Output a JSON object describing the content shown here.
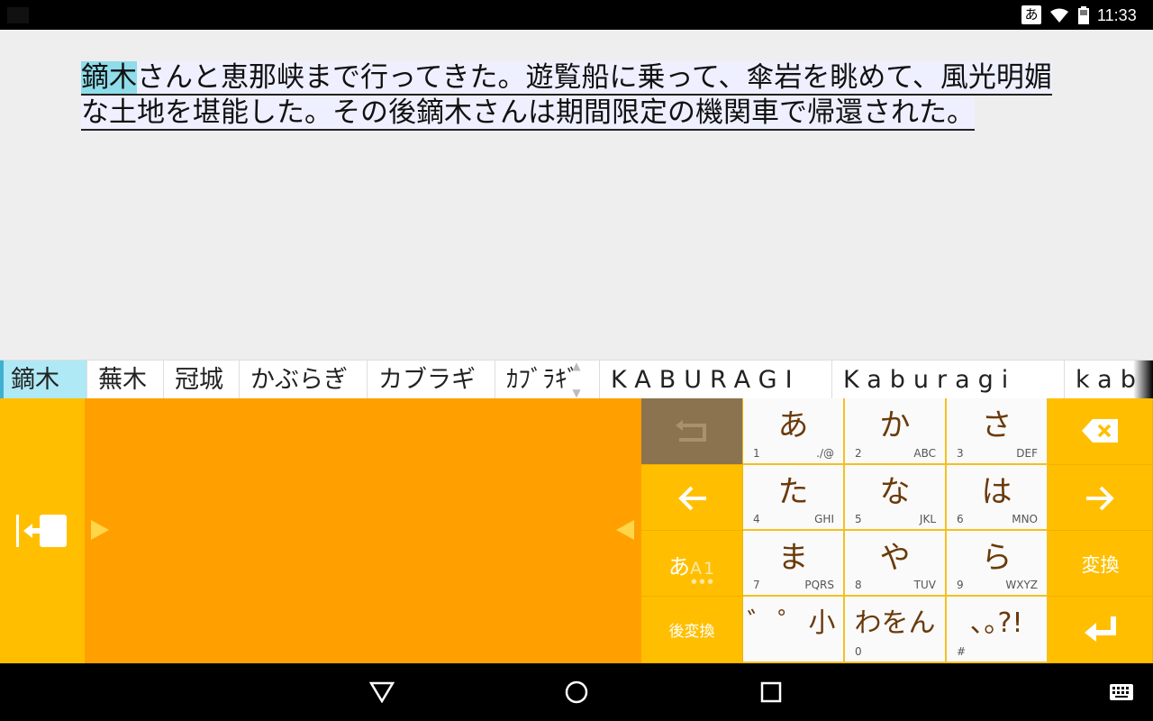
{
  "status_bar": {
    "ime_indicator": "あ",
    "time": "11:33",
    "icons": [
      "wifi-icon",
      "battery-icon"
    ]
  },
  "editor": {
    "selected_text": "鏑木",
    "composing_text": "さんと恵那峡まで行ってきた。遊覧船に乗って、傘岩を眺めて、風光明媚な土地を堪能した。その後鏑木さんは期間限定の機関車で帰還された。"
  },
  "candidates": [
    "鏑木",
    "蕪木",
    "冠城",
    "かぶらぎ",
    "カブラギ",
    "ｶﾌﾞﾗｷﾞ",
    "KABURAGI",
    "Kaburagi",
    "kab"
  ],
  "keyboard": {
    "mode_label_main": "あ",
    "mode_label_sub": "A1",
    "mode_label_dots": "●●●",
    "post_convert_label": "後変換",
    "convert_label": "変換",
    "kana_keys": [
      {
        "main": "あ",
        "num": "1",
        "alpha": "./@"
      },
      {
        "main": "か",
        "num": "2",
        "alpha": "ABC"
      },
      {
        "main": "さ",
        "num": "3",
        "alpha": "DEF"
      },
      {
        "main": "た",
        "num": "4",
        "alpha": "GHI"
      },
      {
        "main": "な",
        "num": "5",
        "alpha": "JKL"
      },
      {
        "main": "は",
        "num": "6",
        "alpha": "MNO"
      },
      {
        "main": "ま",
        "num": "7",
        "alpha": "PQRS"
      },
      {
        "main": "や",
        "num": "8",
        "alpha": "TUV"
      },
      {
        "main": "ら",
        "num": "9",
        "alpha": "WXYZ"
      },
      {
        "main": "゛゜小",
        "num": "",
        "alpha": ""
      },
      {
        "main": "わをん",
        "num": "0",
        "alpha": ""
      },
      {
        "main": "､｡?!",
        "num": "#",
        "alpha": ""
      }
    ]
  },
  "colors": {
    "keyboard_bg": "#ffa000",
    "function_key": "#ffbf00",
    "undo_key": "#8b7350",
    "kana_text": "#6a3a0a",
    "selection": "#8fdcea"
  }
}
